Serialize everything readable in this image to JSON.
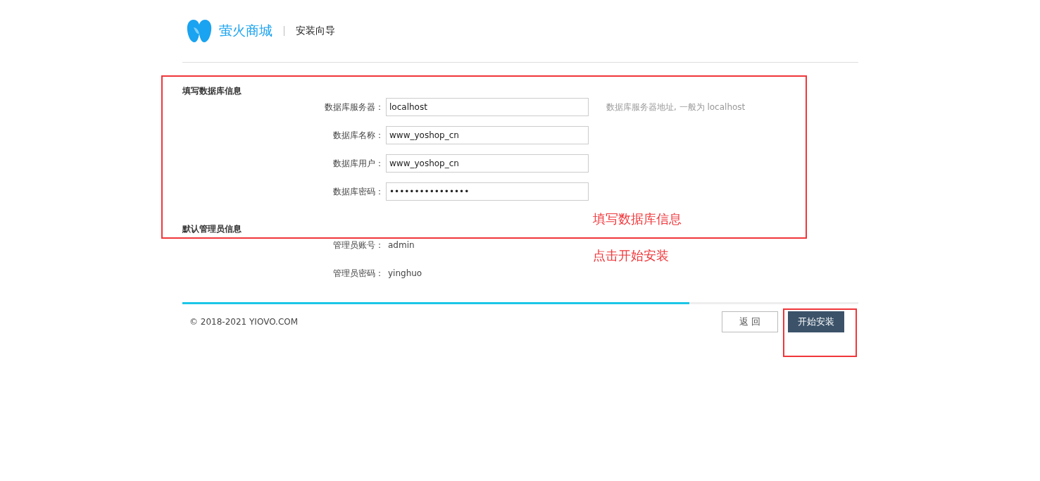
{
  "header": {
    "brand": "萤火商城",
    "title": "安装向导"
  },
  "sections": [
    {
      "title": "填写数据库信息",
      "fields": [
        {
          "kind": "input",
          "label": "数据库服务器：",
          "value": "localhost",
          "hint": "数据库服务器地址, 一般为 localhost"
        },
        {
          "kind": "input",
          "label": "数据库名称：",
          "value": "www_yoshop_cn"
        },
        {
          "kind": "input",
          "label": "数据库用户：",
          "value": "www_yoshop_cn"
        },
        {
          "kind": "input",
          "label": "数据库密码：",
          "value": "••••••••••••••••"
        }
      ]
    },
    {
      "title": "默认管理员信息",
      "fields": [
        {
          "kind": "text",
          "label": "管理员账号：",
          "value": "admin"
        },
        {
          "kind": "text",
          "label": "管理员密码：",
          "value": "yinghuo"
        }
      ]
    }
  ],
  "progress": {
    "level": 0.75
  },
  "footer": {
    "copyright": "© 2018-2021 YIOVO.COM",
    "buttons": [
      {
        "label": "返 回",
        "kind": "secondary"
      },
      {
        "label": "开始安装",
        "kind": "primary"
      }
    ]
  },
  "annotations": [
    {
      "text": "填写数据库信息"
    },
    {
      "text": "点击开始安装"
    }
  ]
}
